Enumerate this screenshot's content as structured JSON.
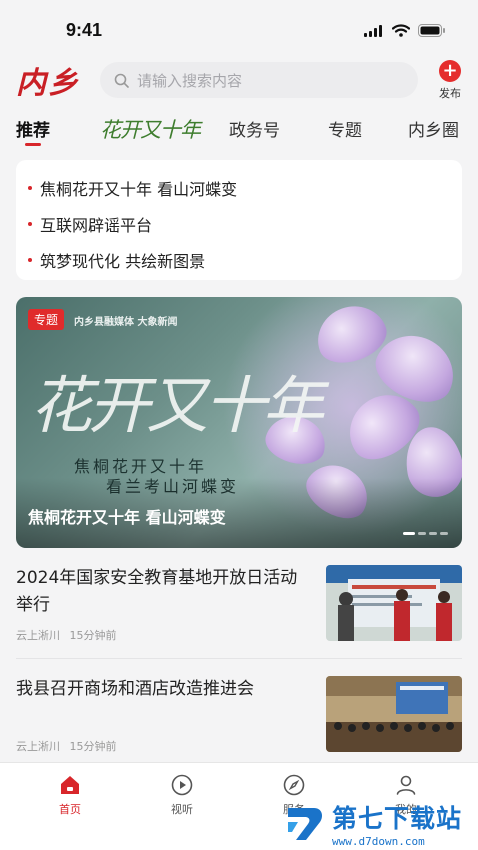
{
  "status_bar": {
    "time": "9:41"
  },
  "header": {
    "logo": "内乡",
    "search_placeholder": "请输入搜索内容",
    "publish_label": "发布"
  },
  "tabs": [
    {
      "label": "推荐",
      "active": true
    },
    {
      "label": "花开又十年",
      "active": false
    },
    {
      "label": "政务号",
      "active": false
    },
    {
      "label": "专题",
      "active": false
    },
    {
      "label": "内乡圈",
      "active": false
    }
  ],
  "headlines": [
    "焦桐花开又十年 看山河蝶变",
    "互联网辟谣平台",
    "筑梦现代化 共绘新图景"
  ],
  "banner": {
    "tag": "专题",
    "logos": "内乡县融媒体  大象新闻",
    "calligraphy": "花开又十年",
    "poem_line1": "焦桐花开又十年",
    "poem_line2": "看兰考山河蝶变",
    "caption": "焦桐花开又十年 看山河蝶变",
    "carousel_count": 4,
    "carousel_active": 0
  },
  "news": [
    {
      "title": "2024年国家安全教育基地开放日活动举行",
      "source": "云上淅川",
      "time": "15分钟前"
    },
    {
      "title": "我县召开商场和酒店改造推进会",
      "source": "云上淅川",
      "time": "15分钟前"
    }
  ],
  "bottom_nav": [
    {
      "label": "首页",
      "icon": "home-icon",
      "active": true
    },
    {
      "label": "视听",
      "icon": "play-icon",
      "active": false
    },
    {
      "label": "服务",
      "icon": "compass-icon",
      "active": false
    },
    {
      "label": "我的",
      "icon": "user-icon",
      "active": false
    }
  ],
  "watermark": {
    "main": "第七下载站",
    "sub": "www.d7down.com"
  },
  "colors": {
    "accent": "#d8262b",
    "watermark": "#1a73c9"
  }
}
